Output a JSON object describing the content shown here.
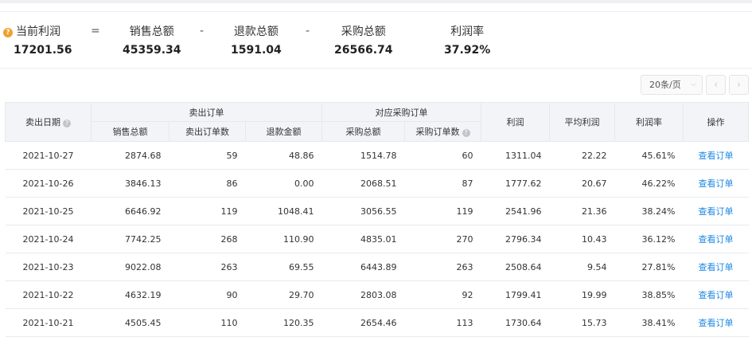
{
  "summary": {
    "profit_label": "当前利润",
    "profit_value": "17201.56",
    "eq": "=",
    "sales_label": "销售总额",
    "sales_value": "45359.34",
    "minus1": "-",
    "refund_label": "退款总额",
    "refund_value": "1591.04",
    "minus2": "-",
    "purchase_label": "采购总额",
    "purchase_value": "26566.74",
    "rate_label": "利润率",
    "rate_value": "37.92%",
    "help_glyph": "?"
  },
  "pager": {
    "page_size": "20条/页",
    "prev": "‹",
    "next": "›",
    "chevron": "⌵"
  },
  "table": {
    "headers": {
      "date": "卖出日期",
      "group_sold": "卖出订单",
      "group_purchase": "对应采购订单",
      "sales_total": "销售总额",
      "sold_count": "卖出订单数",
      "refund_amount": "退款金额",
      "purchase_total": "采购总额",
      "purchase_count": "采购订单数",
      "profit": "利润",
      "avg_profit": "平均利润",
      "profit_rate": "利润率",
      "action": "操作",
      "qmark": "?"
    },
    "rows": [
      {
        "date": "2021-10-27",
        "sales": "2874.68",
        "count": "59",
        "refund": "48.86",
        "purchase": "1514.78",
        "pcount": "60",
        "profit": "1311.04",
        "avg": "22.22",
        "rate": "45.61%",
        "action": "查看订单"
      },
      {
        "date": "2021-10-26",
        "sales": "3846.13",
        "count": "86",
        "refund": "0.00",
        "purchase": "2068.51",
        "pcount": "87",
        "profit": "1777.62",
        "avg": "20.67",
        "rate": "46.22%",
        "action": "查看订单"
      },
      {
        "date": "2021-10-25",
        "sales": "6646.92",
        "count": "119",
        "refund": "1048.41",
        "purchase": "3056.55",
        "pcount": "119",
        "profit": "2541.96",
        "avg": "21.36",
        "rate": "38.24%",
        "action": "查看订单"
      },
      {
        "date": "2021-10-24",
        "sales": "7742.25",
        "count": "268",
        "refund": "110.90",
        "purchase": "4835.01",
        "pcount": "270",
        "profit": "2796.34",
        "avg": "10.43",
        "rate": "36.12%",
        "action": "查看订单"
      },
      {
        "date": "2021-10-23",
        "sales": "9022.08",
        "count": "263",
        "refund": "69.55",
        "purchase": "6443.89",
        "pcount": "263",
        "profit": "2508.64",
        "avg": "9.54",
        "rate": "27.81%",
        "action": "查看订单"
      },
      {
        "date": "2021-10-22",
        "sales": "4632.19",
        "count": "90",
        "refund": "29.70",
        "purchase": "2803.08",
        "pcount": "92",
        "profit": "1799.41",
        "avg": "19.99",
        "rate": "38.85%",
        "action": "查看订单"
      },
      {
        "date": "2021-10-21",
        "sales": "4505.45",
        "count": "110",
        "refund": "120.35",
        "purchase": "2654.46",
        "pcount": "113",
        "profit": "1730.64",
        "avg": "15.73",
        "rate": "38.41%",
        "action": "查看订单"
      }
    ]
  }
}
